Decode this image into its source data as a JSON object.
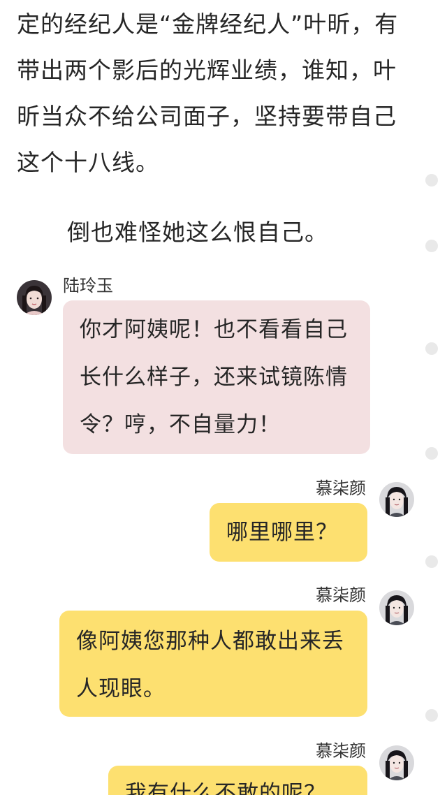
{
  "narration": [
    "定的经纪人是“金牌经纪人”叶昕，有带出两个影后的光辉业绩，谁知，叶昕当众不给公司面子，坚持要带自己这个十八线。",
    "倒也难怪她这么恨自己。"
  ],
  "messages": [
    {
      "speaker": "陆玲玉",
      "side": "left",
      "text": "你才阿姨呢！也不看看自己长什么样子，还来试镜陈情令？哼，不自量力！",
      "bubble_color": "#f3e0e1",
      "avatar": "woman-portrait-icon"
    },
    {
      "speaker": "慕柒颜",
      "side": "right",
      "text": "哪里哪里？",
      "bubble_color": "#fde070",
      "avatar": "girl-portrait-icon"
    },
    {
      "speaker": "慕柒颜",
      "side": "right",
      "text": "像阿姨您那种人都敢出来丢人现眼。",
      "bubble_color": "#fde070",
      "avatar": "girl-portrait-icon"
    },
    {
      "speaker": "慕柒颜",
      "side": "right",
      "text": "我有什么不敢的呢？",
      "bubble_color": "#fde070",
      "avatar": "girl-portrait-icon"
    }
  ],
  "colors": {
    "background": "#ffffff",
    "text": "#262626",
    "side_dot": "#e9e9e9"
  }
}
